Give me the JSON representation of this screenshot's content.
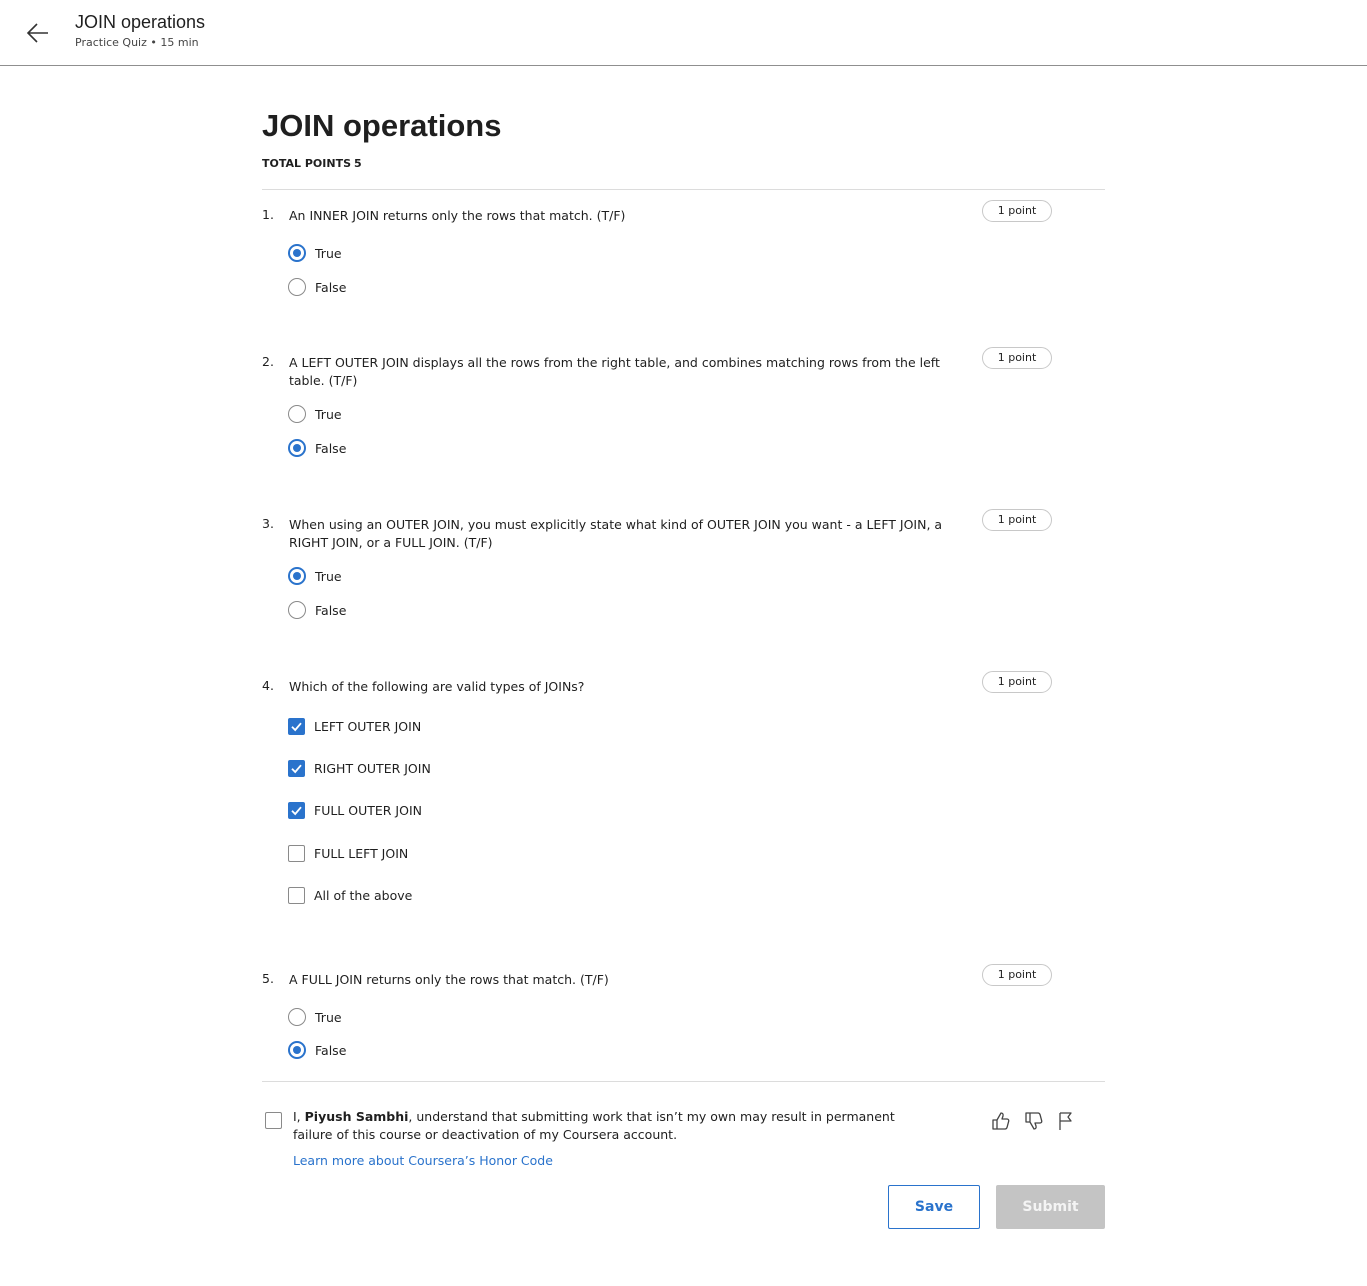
{
  "header": {
    "title": "JOIN operations",
    "subtitle": "Practice Quiz • 15 min",
    "back_icon": "arrow-left-icon"
  },
  "page": {
    "title": "JOIN operations",
    "total_points_label": "TOTAL POINTS",
    "total_points_value": "5"
  },
  "questions": [
    {
      "number": "1.",
      "text": "An INNER JOIN returns only the rows that match. (T/F)",
      "points": "1 point",
      "type": "radio",
      "options": [
        {
          "label": "True",
          "selected": true
        },
        {
          "label": "False",
          "selected": false
        }
      ]
    },
    {
      "number": "2.",
      "text": "A LEFT OUTER JOIN displays all the rows from the right table, and combines matching rows from the left table. (T/F)",
      "points": "1 point",
      "type": "radio",
      "options": [
        {
          "label": "True",
          "selected": false
        },
        {
          "label": "False",
          "selected": true
        }
      ]
    },
    {
      "number": "3.",
      "text": "When using an OUTER JOIN, you must explicitly state what kind of OUTER JOIN you want - a LEFT JOIN, a RIGHT JOIN, or a FULL JOIN. (T/F)",
      "points": "1 point",
      "type": "radio",
      "options": [
        {
          "label": "True",
          "selected": true
        },
        {
          "label": "False",
          "selected": false
        }
      ]
    },
    {
      "number": "4.",
      "text": "Which of the following are valid types of JOINs?",
      "points": "1 point",
      "type": "checkbox",
      "options": [
        {
          "label": "LEFT OUTER JOIN",
          "selected": true
        },
        {
          "label": "RIGHT OUTER JOIN",
          "selected": true
        },
        {
          "label": "FULL OUTER JOIN",
          "selected": true
        },
        {
          "label": "FULL LEFT JOIN",
          "selected": false
        },
        {
          "label": "All of the above",
          "selected": false
        }
      ]
    },
    {
      "number": "5.",
      "text": "A FULL JOIN returns only the rows that match. (T/F)",
      "points": "1 point",
      "type": "radio",
      "options": [
        {
          "label": "True",
          "selected": false
        },
        {
          "label": "False",
          "selected": true
        }
      ]
    }
  ],
  "honor_code": {
    "prefix": "I, ",
    "name": "Piyush Sambhi",
    "suffix": ", understand that submitting work that isn’t my own may result in permanent failure of this course or deactivation of my Coursera account.",
    "link_text": "Learn more about Coursera’s Honor Code",
    "checked": false
  },
  "feedback_icons": [
    "thumbs-up-icon",
    "thumbs-down-icon",
    "flag-icon"
  ],
  "actions": {
    "save_label": "Save",
    "submit_label": "Submit"
  },
  "colors": {
    "accent": "#2a73cc",
    "submit_disabled": "#c4c4c4"
  }
}
